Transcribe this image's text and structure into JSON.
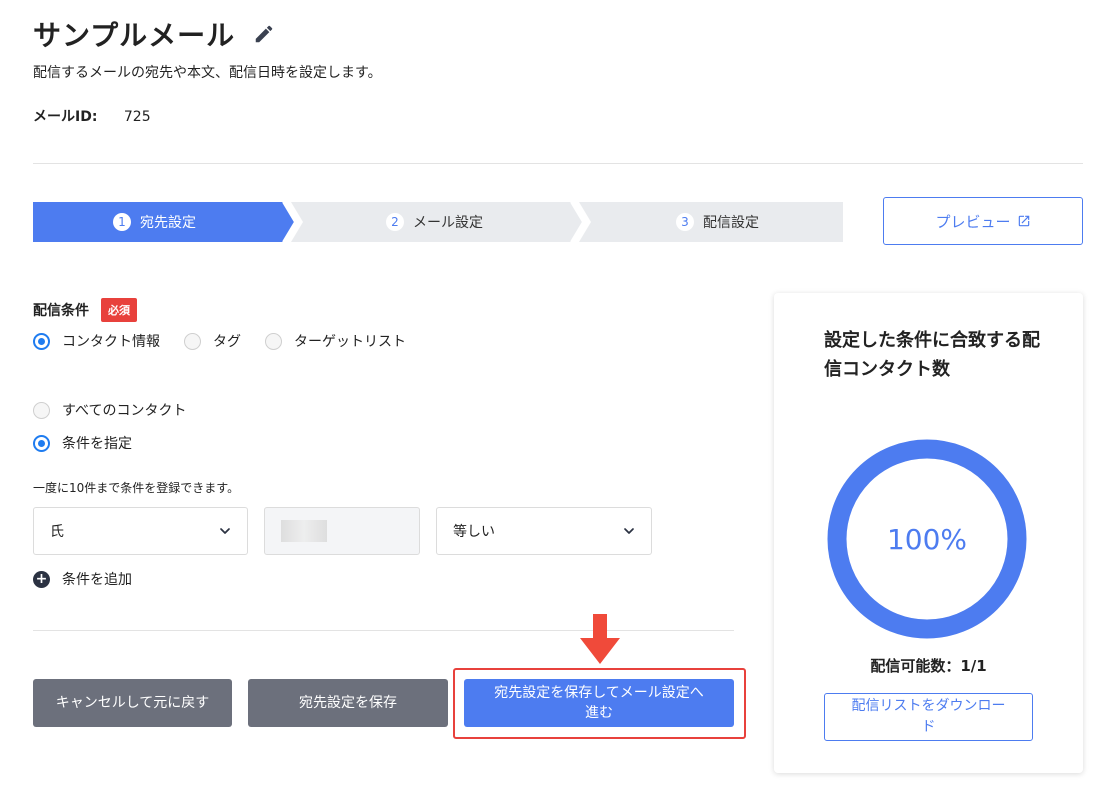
{
  "header": {
    "title": "サンプルメール",
    "subtitle": "配信するメールの宛先や本文、配信日時を設定します。",
    "mail_id_label": "メールID:",
    "mail_id_value": "725"
  },
  "steps": [
    {
      "num": "1",
      "label": "宛先設定",
      "active": true
    },
    {
      "num": "2",
      "label": "メール設定",
      "active": false
    },
    {
      "num": "3",
      "label": "配信設定",
      "active": false
    }
  ],
  "preview_button": "プレビュー",
  "conditions": {
    "label": "配信条件",
    "required_badge": "必須",
    "type_options": [
      {
        "label": "コンタクト情報",
        "checked": true
      },
      {
        "label": "タグ",
        "checked": false
      },
      {
        "label": "ターゲットリスト",
        "checked": false
      }
    ],
    "scope_options": [
      {
        "label": "すべてのコンタクト",
        "checked": false
      },
      {
        "label": "条件を指定",
        "checked": true
      }
    ],
    "hint": "一度に10件まで条件を登録できます。",
    "field_select": "氏",
    "operator_select": "等しい",
    "add_condition": "条件を追加"
  },
  "buttons": {
    "cancel": "キャンセルして元に戻す",
    "save": "宛先設定を保存",
    "save_next": "宛先設定を保存してメール設定へ進む"
  },
  "summary_card": {
    "title": "設定した条件に合致する配信コンタクト数",
    "percent_label": "100%",
    "percent": 100,
    "available": "配信可能数：1/1",
    "download_button": "配信リストをダウンロード"
  },
  "colors": {
    "accent": "#4d7cf0",
    "radio": "#1f7cf0",
    "required": "#e8413c",
    "gray_button": "#6c707c",
    "step_inactive": "#e9ebee"
  }
}
